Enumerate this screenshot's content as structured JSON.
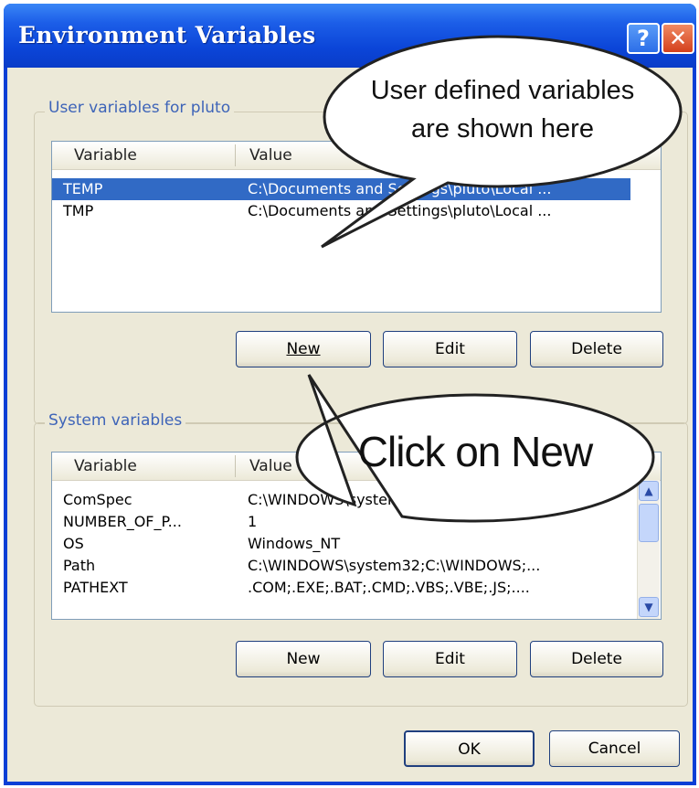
{
  "window": {
    "title": "Environment Variables",
    "help_icon_glyph": "?",
    "close_icon_glyph": "✕"
  },
  "user_group": {
    "label": "User variables for pluto",
    "columns": [
      "Variable",
      "Value"
    ],
    "rows": [
      {
        "variable": "TEMP",
        "value": "C:\\Documents and Settings\\pluto\\Local ...",
        "selected": true
      },
      {
        "variable": "TMP",
        "value": "C:\\Documents and Settings\\pluto\\Local ...",
        "selected": false
      }
    ],
    "buttons": {
      "new": "New",
      "edit": "Edit",
      "delete": "Delete"
    }
  },
  "system_group": {
    "label": "System variables",
    "columns": [
      "Variable",
      "Value"
    ],
    "rows": [
      {
        "variable": "ComSpec",
        "value": "C:\\WINDOWS\\system32\\cmd.exe"
      },
      {
        "variable": "NUMBER_OF_P...",
        "value": "1"
      },
      {
        "variable": "OS",
        "value": "Windows_NT"
      },
      {
        "variable": "Path",
        "value": "C:\\WINDOWS\\system32;C:\\WINDOWS;..."
      },
      {
        "variable": "PATHEXT",
        "value": ".COM;.EXE;.BAT;.CMD;.VBS;.VBE;.JS;...."
      }
    ],
    "buttons": {
      "new": "New",
      "edit": "Edit",
      "delete": "Delete"
    }
  },
  "footer": {
    "ok": "OK",
    "cancel": "Cancel"
  },
  "callouts": {
    "user_line1": "User defined variables",
    "user_line2": "are shown here",
    "new_text": "Click on New"
  },
  "colors": {
    "titlebar": "#0b45d8",
    "selection": "#316ac5",
    "dialog_bg": "#ece9d8",
    "group_label": "#3e64b8"
  }
}
